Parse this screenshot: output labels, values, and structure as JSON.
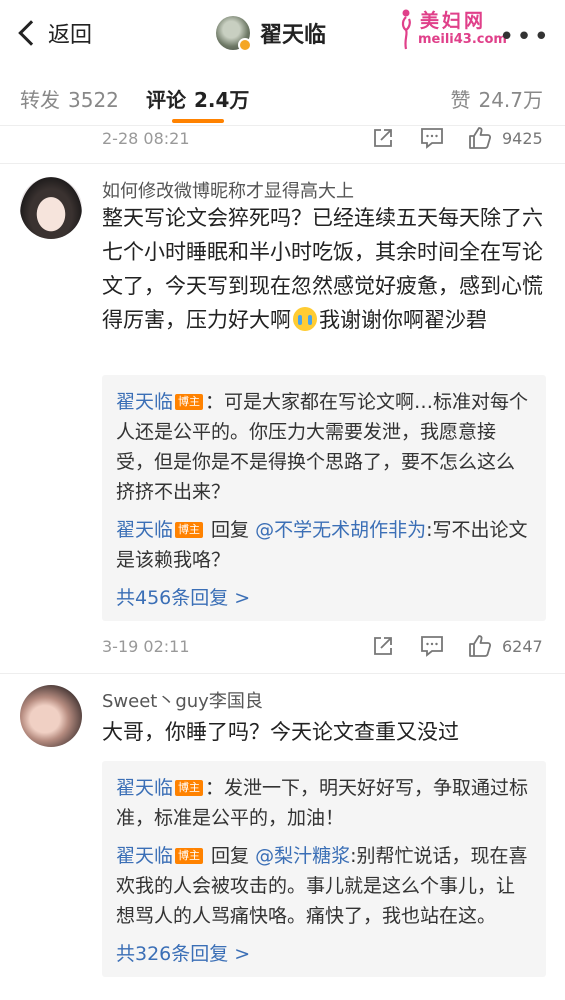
{
  "nav": {
    "back_label": "返回",
    "title": "翟天临",
    "more": "•••",
    "watermark_title": "美妇网",
    "watermark_url": "meili43.com"
  },
  "tabs": {
    "forward_label": "转发",
    "forward_count": "3522",
    "comment_label": "评论",
    "comment_count": "2.4万",
    "like_label": "赞",
    "like_count": "24.7万"
  },
  "top_meta": {
    "time": "2-28 08:21",
    "likes": "9425"
  },
  "comments": [
    {
      "username": "如何修改微博昵称才显得高大上",
      "text_before_emoji": "整天写论文会猝死吗？已经连续五天每天除了六七个小时睡眠和半小时吃饭，其余时间全在写论文了，今天写到现在忽然感觉好疲惫，感到心慌得厉害，压力好大啊",
      "emoji": "crying-emoji",
      "text_after_emoji": "我谢谢你啊翟沙碧",
      "replies": [
        {
          "name": "翟天临",
          "badge": "博主",
          "text": "：可是大家都在写论文啊…标准对每个人还是公平的。你压力大需要发泄，我愿意接受，但是你是不是得换个思路了，要不怎么这么挤挤不出来？"
        },
        {
          "name": "翟天临",
          "badge": "博主",
          "reply_word": " 回复 ",
          "mention": "@不学无术胡作非为",
          "text": ":写不出论文是该赖我咯？"
        }
      ],
      "more_replies": "共456条回复 >",
      "time": "3-19 02:11",
      "likes": "6247"
    },
    {
      "username": "Sweet丶guy李国良",
      "text": "大哥，你睡了吗？今天论文查重又没过",
      "replies": [
        {
          "name": "翟天临",
          "badge": "博主",
          "text": "：发泄一下，明天好好写，争取通过标准，标准是公平的，加油！"
        },
        {
          "name": "翟天临",
          "badge": "博主",
          "reply_word": " 回复 ",
          "mention": "@梨汁糖浆",
          "text": ":别帮忙说话，现在喜欢我的人会被攻击的。事儿就是这么个事儿，让想骂人的人骂痛快咯。痛快了，我也站在这。"
        }
      ],
      "more_replies": "共326条回复 >"
    }
  ]
}
